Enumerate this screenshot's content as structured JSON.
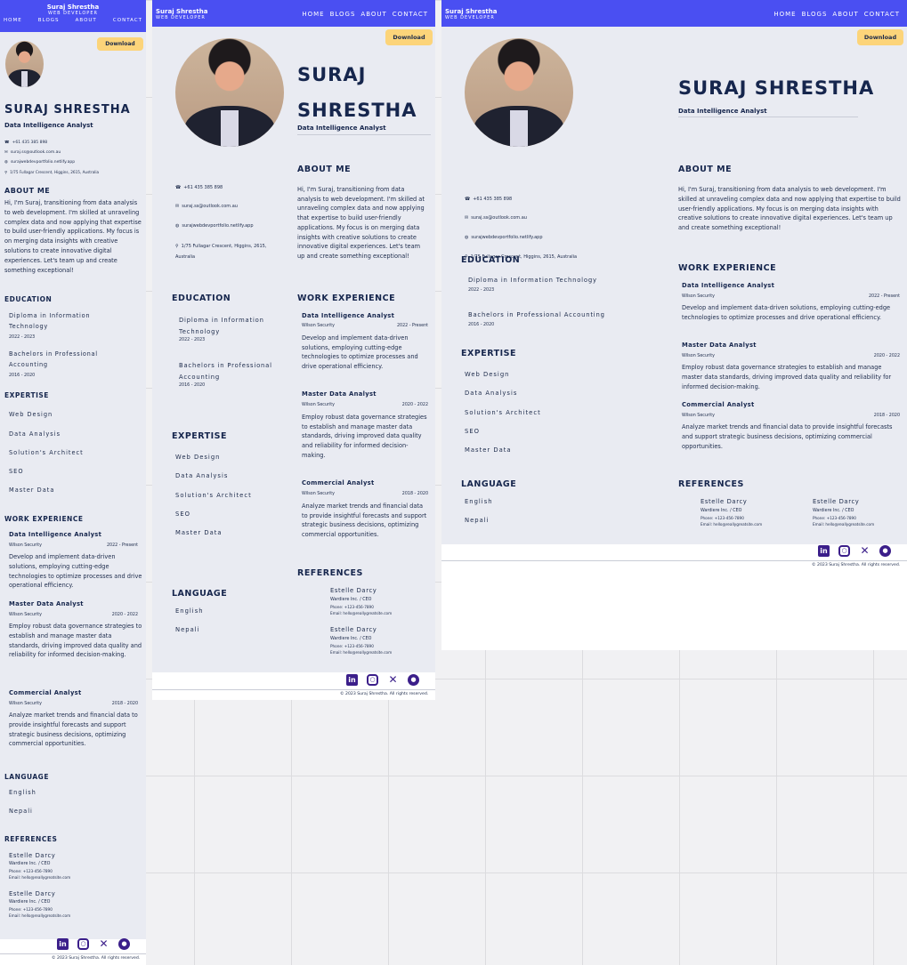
{
  "brand": {
    "name": "Suraj Shrestha",
    "sub": "WEB DEVELOPER"
  },
  "nav": {
    "home": "HOME",
    "blogs": "BLOGS",
    "about": "ABOUT",
    "contact": "CONTACT"
  },
  "nav_mobile": {
    "home": "HOME",
    "blogs": "BLOGS",
    "about": "ABOUT",
    "contact": "CONTACT"
  },
  "download": "Download",
  "profile": {
    "name": "SURAJ SHRESTHA",
    "name_line1": "SURAJ",
    "name_line2": "SHRESTHA",
    "title": "Data Intelligence Analyst"
  },
  "contact": {
    "phone": "+61 435 385 898",
    "email": "suraj.ss@outlook.com.au",
    "web": "surajwebdevportfolio.netlify.app",
    "address": "1/75 Fullagar Crescent, Higgins, 2615, Australia",
    "address_l1": "1/75 Fullagar Crescent, Higgins, 2615,",
    "address_l2": "Australia"
  },
  "about": {
    "heading": "ABOUT ME",
    "text": "Hi, I'm Suraj, transitioning from data analysis to web development. I'm skilled at unraveling complex data and now applying that expertise to build user-friendly applications. My focus is on merging data insights with creative solutions to create innovative digital experiences. Let's team up and create something exceptional!"
  },
  "education": {
    "heading": "EDUCATION",
    "items": [
      {
        "name": "Diploma in Information Technology",
        "years": "2022 - 2023"
      },
      {
        "name": "Bachelors in Professional Accounting",
        "years": "2016 - 2020"
      }
    ]
  },
  "expertise": {
    "heading": "EXPERTISE",
    "items": [
      "Web Design",
      "Data Analysis",
      "Solution's Architect",
      "SEO",
      "Master Data"
    ]
  },
  "work": {
    "heading": "WORK EXPERIENCE",
    "jobs": [
      {
        "title": "Data Intelligence Analyst",
        "company": "Wilson Security",
        "period": "2022 - Present",
        "desc": "Develop and implement data-driven solutions, employing cutting-edge technologies to optimize processes and drive operational efficiency."
      },
      {
        "title": "Master Data Analyst",
        "company": "Wilson Security",
        "period": "2020 - 2022",
        "desc": "Employ robust data governance strategies to establish and manage master data standards, driving improved data quality and reliability for informed decision-making."
      },
      {
        "title": "Commercial Analyst",
        "company": "Wilson Security",
        "period": "2018 - 2020",
        "desc": "Analyze market trends and financial data to provide insightful forecasts and support strategic business decisions, optimizing commercial opportunities."
      }
    ]
  },
  "language": {
    "heading": "LANGUAGE",
    "items": [
      "English",
      "Nepali"
    ]
  },
  "references": {
    "heading": "REFERENCES",
    "items": [
      {
        "name": "Estelle Darcy",
        "role": "Wardiere Inc. / CEO",
        "phone": "Phone: +123-456-7890",
        "email": "Email: hello@reallygreatsite.com"
      },
      {
        "name": "Estelle Darcy",
        "role": "Wardiere Inc. / CEO",
        "phone": "Phone: +123-456-7890",
        "email": "Email: hello@reallygreatsite.com"
      }
    ]
  },
  "footer": {
    "copyright": "© 2023 Suraj Shrestha. All rights reserved."
  },
  "colors": {
    "nav": "#4a4ff2",
    "page": "#e9ebf2",
    "navy": "#16264d",
    "download": "#fcd47a",
    "social": "#3b1e8a"
  },
  "icons": [
    "phone-icon",
    "mail-icon",
    "globe-icon",
    "location-icon",
    "linkedin-icon",
    "instagram-icon",
    "x-icon",
    "github-icon"
  ]
}
